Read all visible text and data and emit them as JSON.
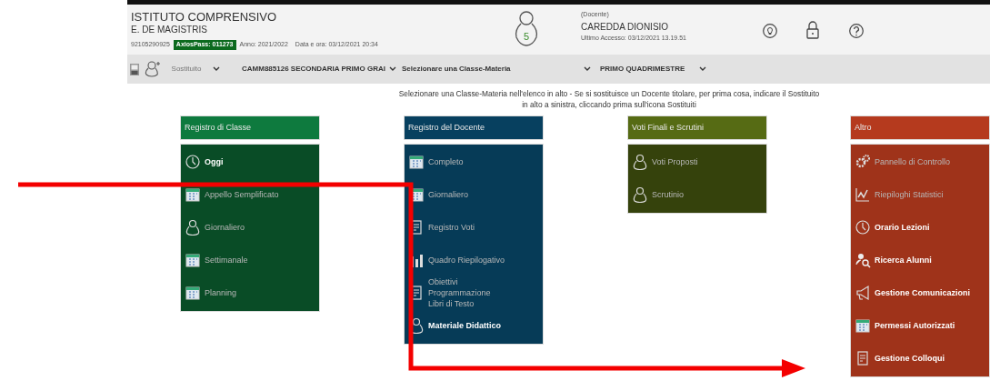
{
  "header": {
    "school_line1": "ISTITUTO COMPRENSIVO",
    "school_line2": "E. DE MAGISTRIS",
    "code": "92105290925",
    "pass_badge": "AxiosPass: 011273",
    "year": "Anno: 2021/2022",
    "datetime": "Data e ora: 03/12/2021 20:34",
    "avatar_count": "5",
    "role": "(Docente)",
    "user_name": "CAREDDA DIONISIO",
    "last_access": "Ultimo Accesso: 03/12/2021 13.19.51"
  },
  "toolbar": {
    "substitute": "Sostituito",
    "school": "CAMM885126 SECONDARIA PRIMO GRAI",
    "class_subject": "Selezionare una Classe-Materia",
    "period": "PRIMO QUADRIMESTRE"
  },
  "instructions": "Selezionare una Classe-Materia nell'elenco in alto - Se si sostituisce un Docente titolare, per prima cosa, indicare il Sostituito in alto a sinistra, cliccando prima sull'icona Sostituiti",
  "panels": [
    {
      "title": "Registro di Classe",
      "color": "#0e7a3e",
      "items": [
        {
          "label": "Oggi",
          "disabled": false
        },
        {
          "label": "Appello Semplificato",
          "disabled": true
        },
        {
          "label": "Giornaliero",
          "disabled": true
        },
        {
          "label": "Settimanale",
          "disabled": true
        },
        {
          "label": "Planning",
          "disabled": true
        }
      ]
    },
    {
      "title": "Registro del Docente",
      "color": "#07405f",
      "items": [
        {
          "label": "Completo",
          "disabled": true
        },
        {
          "label": "Giornaliero",
          "disabled": true
        },
        {
          "label": "Registro Voti",
          "disabled": true
        },
        {
          "label": "Quadro Riepilogativo",
          "disabled": true
        },
        {
          "label": "Obiettivi\nProgrammazione\nLibri di Testo",
          "disabled": true
        },
        {
          "label": "Materiale Didattico",
          "disabled": false
        }
      ]
    },
    {
      "title": "Voti Finali e Scrutini",
      "color": "#566b14",
      "items": [
        {
          "label": "Voti Proposti",
          "disabled": true
        },
        {
          "label": "Scrutinio",
          "disabled": true
        }
      ]
    },
    {
      "title": "Altro",
      "color": "#b53a1e",
      "items": [
        {
          "label": "Pannello di Controllo",
          "disabled": true
        },
        {
          "label": "Riepiloghi Statistici",
          "disabled": true
        },
        {
          "label": "Orario Lezioni",
          "disabled": false
        },
        {
          "label": "Ricerca Alunni",
          "disabled": false
        },
        {
          "label": "Gestione Comunicazioni",
          "disabled": false
        },
        {
          "label": "Permessi Autorizzati",
          "disabled": false
        },
        {
          "label": "Gestione Colloqui",
          "disabled": false
        }
      ]
    }
  ]
}
